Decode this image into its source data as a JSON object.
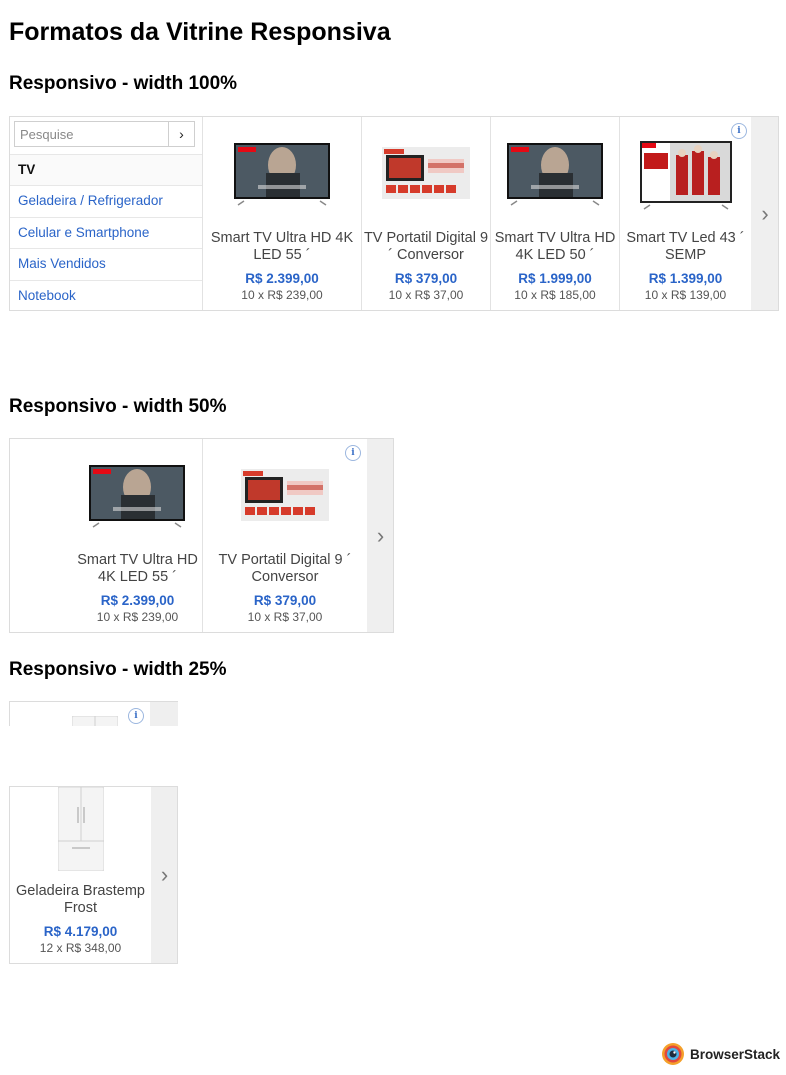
{
  "page_title": "Formatos da Vitrine Responsiva",
  "sections": {
    "s100": {
      "title": "Responsivo - width 100%"
    },
    "s50": {
      "title": "Responsivo - width 50%"
    },
    "s25": {
      "title": "Responsivo - width 25%"
    }
  },
  "sidebar": {
    "search_placeholder": "Pesquise",
    "search_button": "›",
    "items": [
      "TV",
      "Geladeira / Refrigerador",
      "Celular e Smartphone",
      "Mais Vendidos",
      "Notebook"
    ]
  },
  "products": [
    {
      "name": "Smart TV Ultra HD 4K LED 55 ´",
      "price": "R$ 2.399,00",
      "installments": "10 x R$ 239,00",
      "image": "tv-netflix"
    },
    {
      "name": "TV Portatil Digital 9 ´ Conversor",
      "price": "R$ 379,00",
      "installments": "10 x R$ 37,00",
      "image": "portable-tv"
    },
    {
      "name": "Smart TV Ultra HD 4K LED 50 ´",
      "price": "R$ 1.999,00",
      "installments": "10 x R$ 185,00",
      "image": "tv-netflix"
    },
    {
      "name": "Smart TV Led 43 ´ SEMP",
      "price": "R$ 1.399,00",
      "installments": "10 x R$ 139,00",
      "image": "tv-lacasadepapel"
    }
  ],
  "fridge": {
    "name": "Geladeira Brastemp Frost",
    "price": "R$ 4.179,00",
    "installments": "12 x R$ 348,00",
    "image": "fridge"
  },
  "next_arrow": "›",
  "info_icon": "i",
  "image_texts": {
    "netflix": "NETFLIX",
    "tv_caption": "ALTERED CARBON",
    "tomate": "Tomate",
    "monitor": "MONITOR",
    "casa_papel": "LA CASA PAPEL"
  },
  "browserstack_label": "BrowserStack",
  "colors": {
    "price": "#2a64c8",
    "link": "#2a64c8",
    "arrow_bg": "#efefef",
    "netflix": "#e50914"
  }
}
